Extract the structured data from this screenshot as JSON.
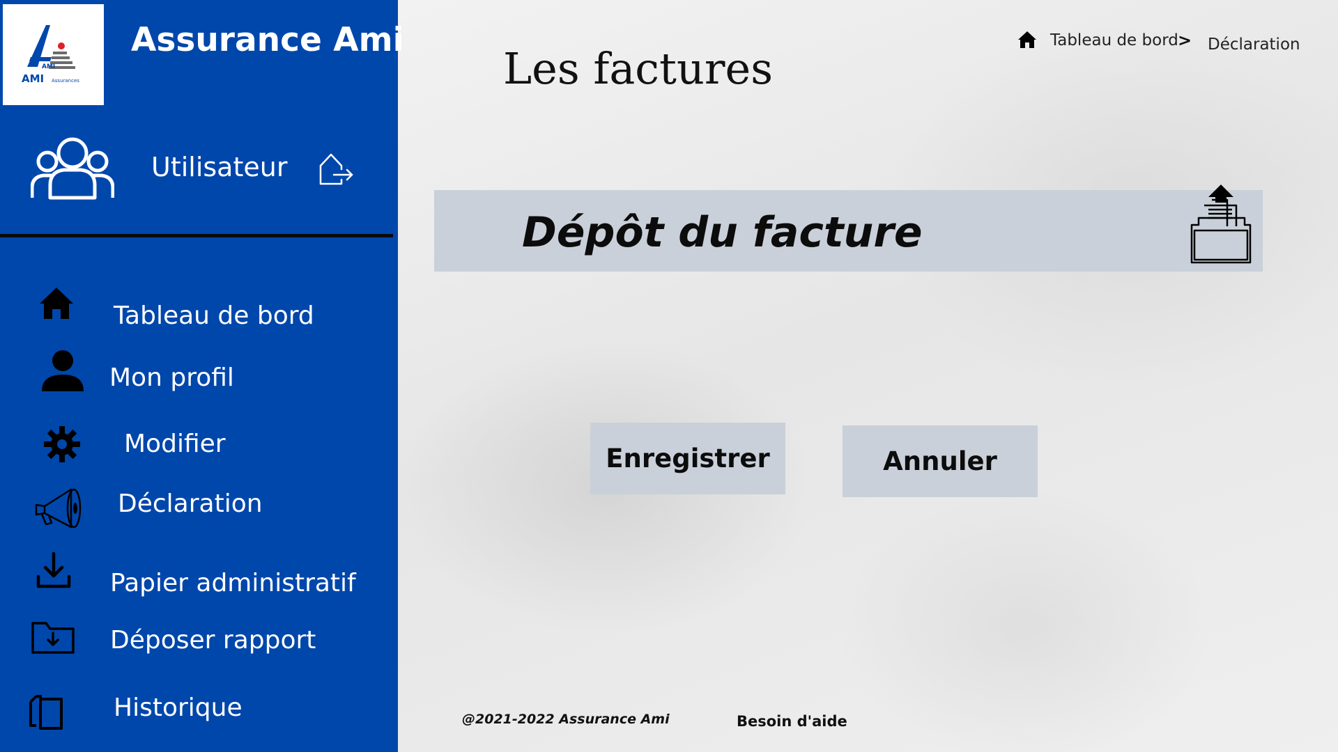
{
  "brand": {
    "name": "Assurance Ami",
    "logo_text_primary": "AMI",
    "logo_text_secondary": "AMI Assurances"
  },
  "user": {
    "label": "Utilisateur"
  },
  "sidebar": {
    "items": [
      {
        "label": "Tableau de bord",
        "icon": "home-icon"
      },
      {
        "label": "Mon profil",
        "icon": "user-icon"
      },
      {
        "label": "Modifier",
        "icon": "gear-icon"
      },
      {
        "label": "Déclaration",
        "icon": "megaphone-icon"
      },
      {
        "label": "Papier administratif",
        "icon": "download-icon"
      },
      {
        "label": "Déposer rapport",
        "icon": "folder-download-icon"
      },
      {
        "label": "Historique",
        "icon": "history-icon"
      }
    ]
  },
  "header": {
    "title": "Les factures",
    "breadcrumb": {
      "home_label": "Tableau de bord",
      "separator": ">",
      "current_label": "Déclaration"
    }
  },
  "main": {
    "banner_title": "Dépôt du facture",
    "save_label": "Enregistrer",
    "cancel_label": "Annuler"
  },
  "footer": {
    "copyright": "@2021-2022 Assurance Ami",
    "help_label": "Besoin d'aide"
  },
  "colors": {
    "sidebar_bg": "#0047ab",
    "button_bg": "#c9d0d9",
    "logo_red": "#e0202a"
  }
}
